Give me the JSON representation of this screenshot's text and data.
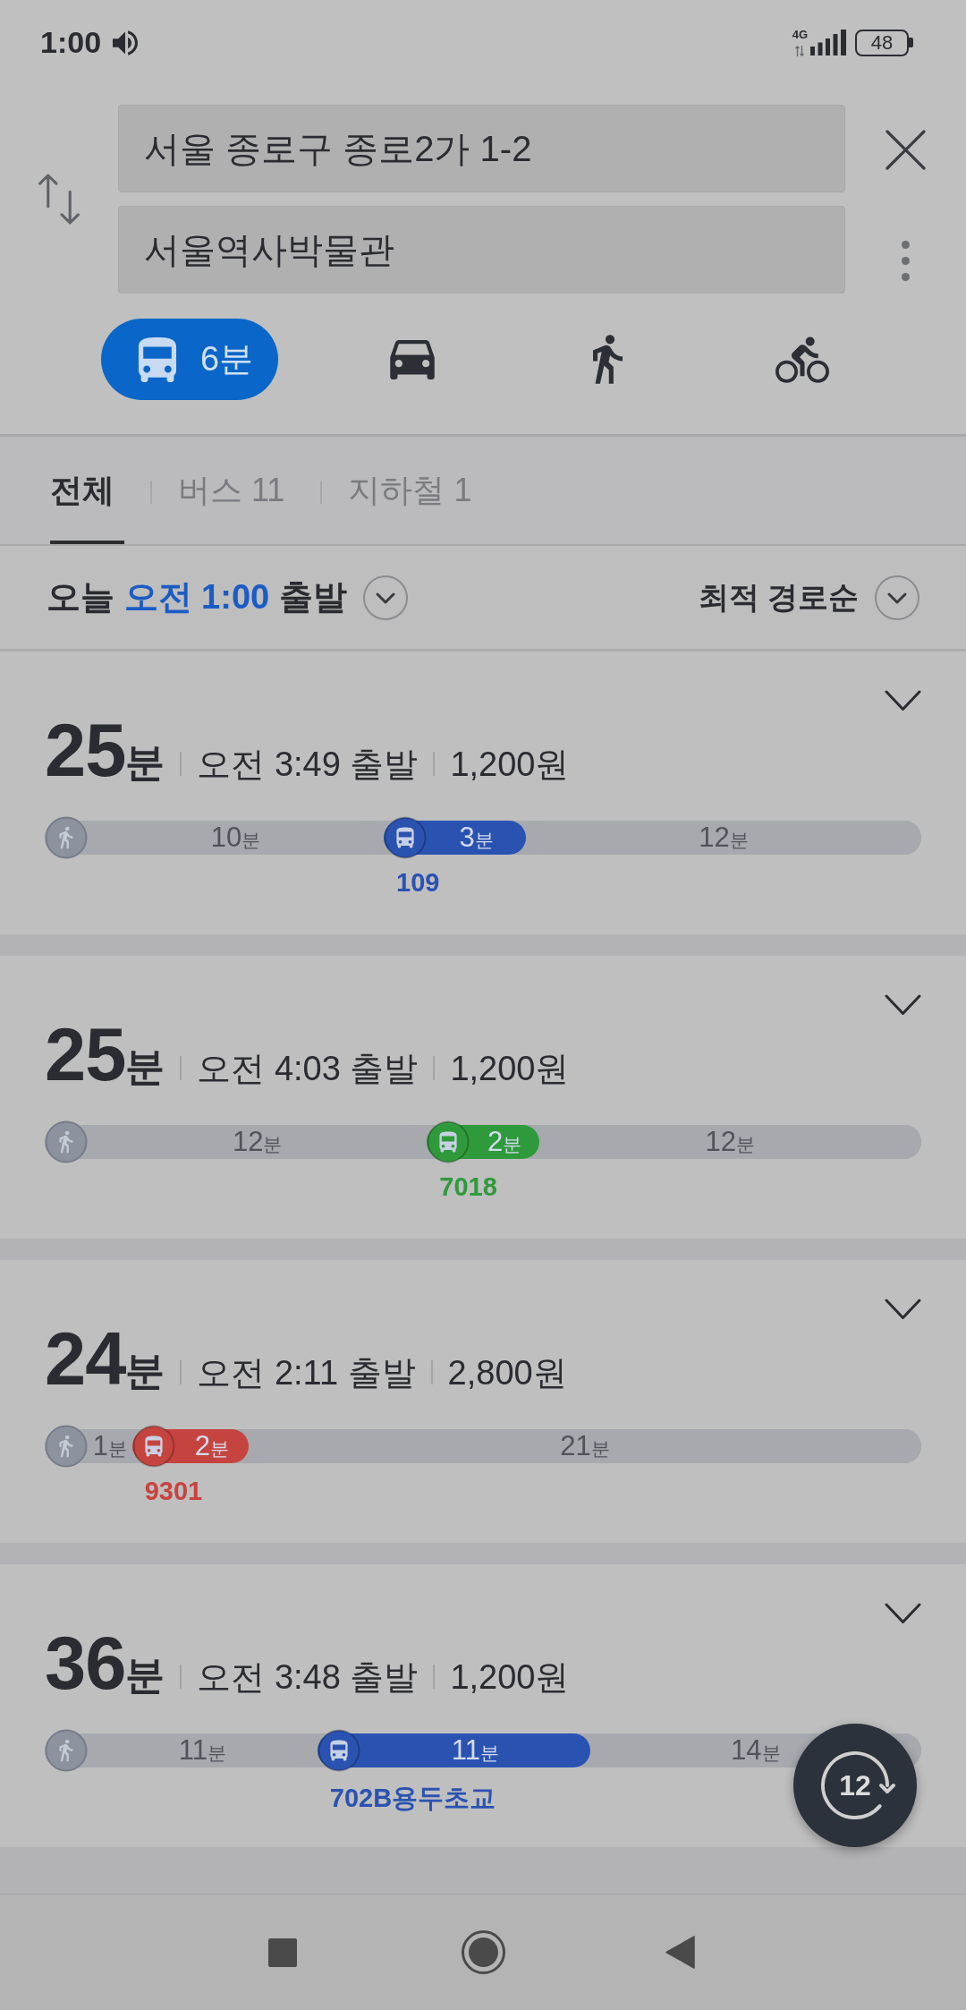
{
  "status_bar": {
    "time": "1:00",
    "network": "4G",
    "battery": "48"
  },
  "search": {
    "origin": "서울 종로구 종로2가 1-2",
    "destination": "서울역사박물관"
  },
  "modes": [
    {
      "kind": "transit",
      "label": "6분",
      "selected": true
    },
    {
      "kind": "car",
      "selected": false
    },
    {
      "kind": "walk",
      "selected": false
    },
    {
      "kind": "bike",
      "selected": false
    }
  ],
  "tabs": [
    {
      "label": "전체",
      "selected": true
    },
    {
      "label": "버스 11",
      "selected": false
    },
    {
      "label": "지하철 1",
      "selected": false
    }
  ],
  "departure": {
    "prefix": "오늘",
    "time": "오전 1:00",
    "suffix": "출발"
  },
  "sort": {
    "label": "최적 경로순"
  },
  "routes": [
    {
      "duration": "25",
      "duration_unit": "분",
      "departure": "오전 3:49 출발",
      "fare": "1,200원",
      "expanded": false,
      "segments": [
        {
          "kind": "walk",
          "marker": true,
          "time": "10",
          "unit": "분"
        },
        {
          "kind": "bus",
          "time": "3",
          "unit": "분",
          "color": "#2a52b1",
          "line": "109"
        },
        {
          "kind": "walk",
          "marker": false,
          "time": "12",
          "unit": "분"
        }
      ]
    },
    {
      "duration": "25",
      "duration_unit": "분",
      "departure": "오전 4:03 출발",
      "fare": "1,200원",
      "expanded": false,
      "segments": [
        {
          "kind": "walk",
          "marker": true,
          "time": "12",
          "unit": "분"
        },
        {
          "kind": "bus",
          "time": "2",
          "unit": "분",
          "color": "#2f9a3b",
          "line": "7018"
        },
        {
          "kind": "walk",
          "marker": false,
          "time": "12",
          "unit": "분"
        }
      ]
    },
    {
      "duration": "24",
      "duration_unit": "분",
      "departure": "오전 2:11 출발",
      "fare": "2,800원",
      "expanded": false,
      "segments": [
        {
          "kind": "walk",
          "marker": true,
          "time": "1",
          "unit": "분"
        },
        {
          "kind": "bus",
          "time": "2",
          "unit": "분",
          "color": "#c6443f",
          "line": "9301"
        },
        {
          "kind": "walk",
          "marker": false,
          "time": "21",
          "unit": "분"
        }
      ]
    },
    {
      "duration": "36",
      "duration_unit": "분",
      "departure": "오전 3:48 출발",
      "fare": "1,200원",
      "expanded": false,
      "segments": [
        {
          "kind": "walk",
          "marker": true,
          "time": "11",
          "unit": "분"
        },
        {
          "kind": "bus",
          "time": "11",
          "unit": "분",
          "color": "#2a52b1",
          "line": "702B용두초교"
        },
        {
          "kind": "walk",
          "marker": false,
          "time": "14",
          "unit": "분"
        }
      ]
    }
  ],
  "refresh_button": {
    "label": "12"
  }
}
